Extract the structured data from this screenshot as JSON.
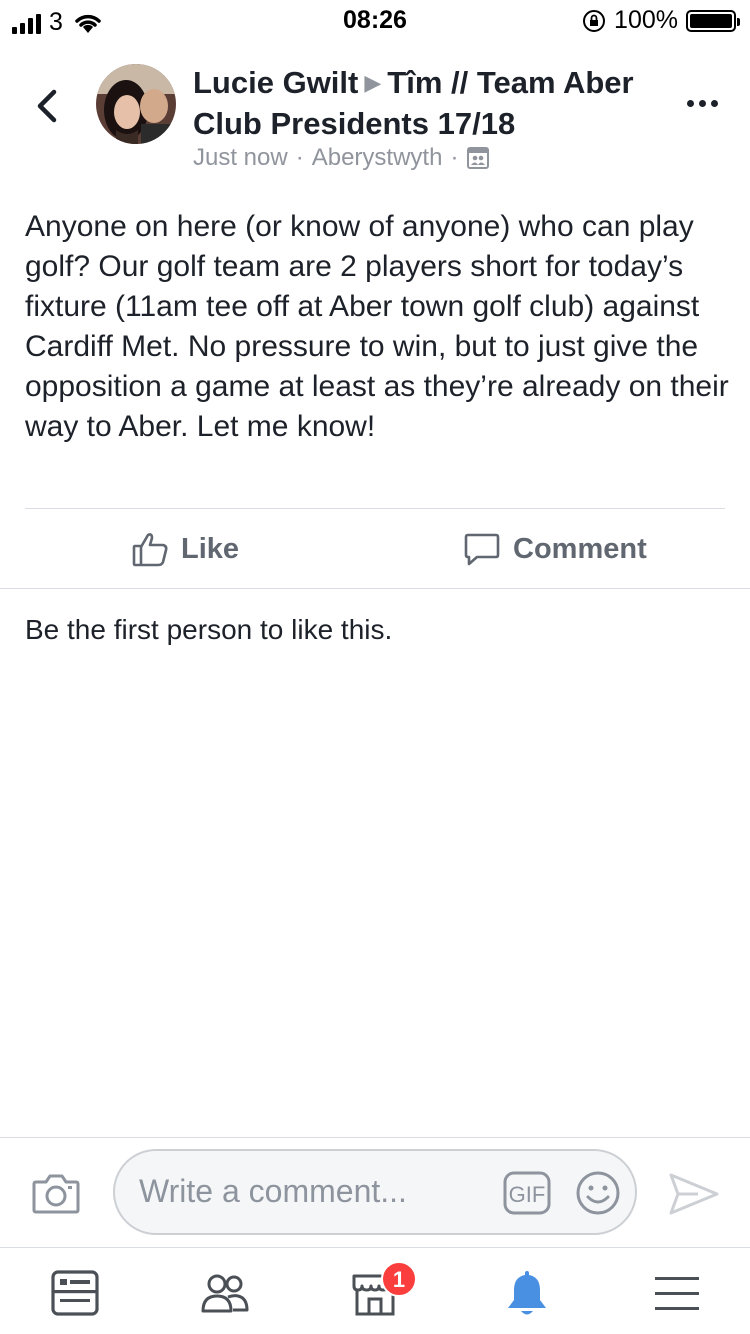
{
  "status_bar": {
    "carrier": "3",
    "time": "08:26",
    "battery": "100%"
  },
  "post": {
    "author": "Lucie Gwilt",
    "group": "Tîm // Team Aber Club Presidents 17/18",
    "time": "Just now",
    "location": "Aberystwyth",
    "body": "Anyone on here (or know of anyone) who can play golf? Our golf team are 2 players short for today’s fixture (11am tee off at Aber town golf club) against Cardiff Met. No pressure to win, but to just give the opposition a game at least as they’re already on their way to Aber. Let me know!"
  },
  "actions": {
    "like_label": "Like",
    "comment_label": "Comment"
  },
  "likes_summary": "Be the first person to like this.",
  "comment_bar": {
    "placeholder": "Write a comment...",
    "gif_label": "GIF"
  },
  "tab_bar": {
    "marketplace_badge": "1",
    "active_tab": "notifications",
    "active_color": "#4a90e2"
  }
}
